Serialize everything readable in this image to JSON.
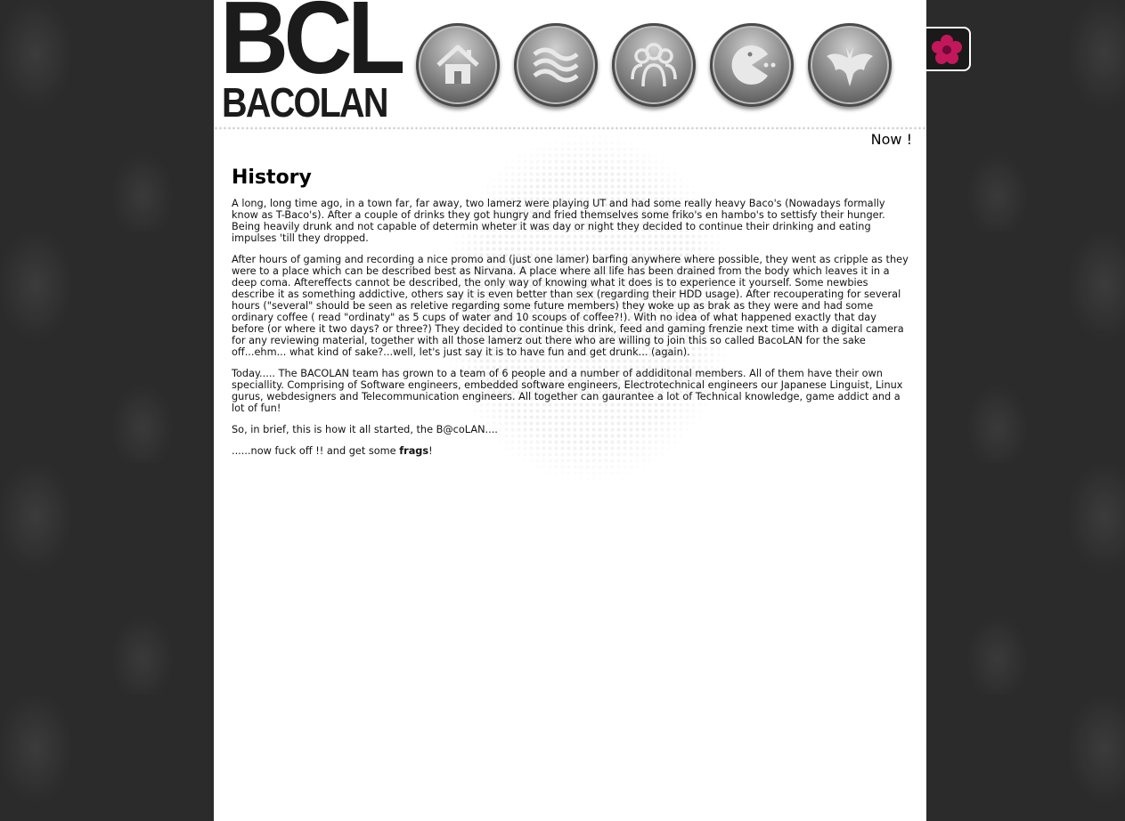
{
  "header": {
    "logo_top": "BCL",
    "logo_bottom": "BACOLAN",
    "nav": [
      {
        "icon": "home-icon"
      },
      {
        "icon": "waves-icon"
      },
      {
        "icon": "people-icon"
      },
      {
        "icon": "pacman-icon"
      },
      {
        "icon": "bat-icon"
      }
    ],
    "side_tab_icon": "flower-icon",
    "now_label": "Now !"
  },
  "article": {
    "title": "History",
    "p1": "A long, long time ago, in a town far, far away, two lamerz were playing UT and had some really heavy Baco's (Nowadays formally know as T-Baco's). After a couple of drinks they got hungry and fried themselves some friko's en hambo's to settisfy their hunger. Being heavily drunk and not capable of determin wheter it was day or night they decided to continue their drinking and eating impulses 'till they dropped.",
    "p2": "After hours of gaming and recording a nice promo and (just one lamer) barfing anywhere where possible, they went as cripple as they were to a place which can be described best as Nirvana. A place where all life has been drained from the body which leaves it in a deep coma. Aftereffects cannot be described, the only way of knowing what it does is to experience it yourself. Some newbies describe it as something addictive, others say it is even better than sex (regarding their HDD usage). After recouperating for several hours (\"several\" should be seen as reletive regarding some future members) they woke up as brak as they were and had some ordinary coffee ( read \"ordinaty\" as 5 cups of water and 10 scoups of coffee?!). With no idea of what happened exactly that day before (or where it two days? or three?) They decided to continue this drink, feed and gaming frenzie next time with a digital camera for any reviewing material, together with all those lamerz out there who are willing to join this so called BacoLAN for the sake off...ehm... what kind of sake?...well, let's just say it is to have fun and get drunk... (again).",
    "p3": "Today..... The BACOLAN team has grown to a  team of 6 people and a number of addiditonal members. All of them have their own speciallity. Comprising of Software engineers, embedded software engineers, Electrotechnical engineers our Japanese Linguist, Linux gurus, webdesigners and Telecommunication engineers. All together can gaurantee a lot of Technical knowledge, game addict and a lot of fun!",
    "p4": "So, in brief, this is how it all started, the B@coLAN....",
    "p5_pre": "......now fuck off !! and get some ",
    "p5_bold": "frags",
    "p5_post": "!"
  }
}
